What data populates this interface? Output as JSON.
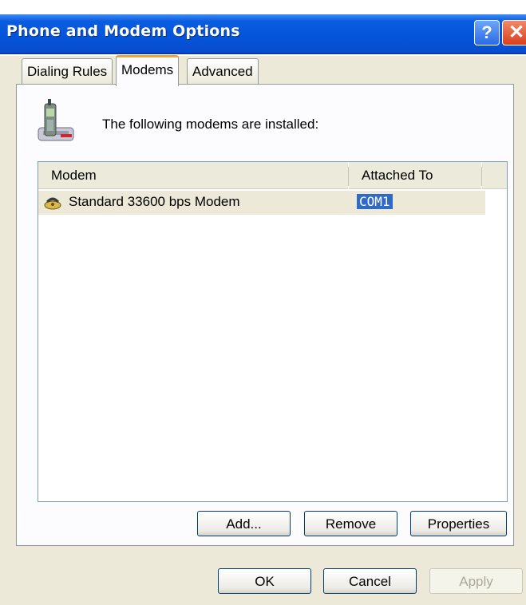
{
  "window": {
    "title": "Phone and Modem Options",
    "help_glyph": "?",
    "close_glyph": "✕"
  },
  "tabs": [
    {
      "label": "Dialing Rules",
      "active": false
    },
    {
      "label": "Modems",
      "active": true
    },
    {
      "label": "Advanced",
      "active": false
    }
  ],
  "modems_panel": {
    "intro_text": "The following modems are  installed:",
    "columns": [
      "Modem",
      "Attached To"
    ],
    "rows": [
      {
        "modem": "Standard 33600 bps Modem",
        "attached_to": "COM1",
        "selected": true
      }
    ],
    "buttons": {
      "add": "Add...",
      "remove": "Remove",
      "properties": "Properties"
    }
  },
  "dialog_buttons": {
    "ok": "OK",
    "cancel": "Cancel",
    "apply": "Apply",
    "apply_enabled": false
  },
  "colors": {
    "titlebar": "#0354d8",
    "selection": "#316ac5",
    "tab_highlight": "#e8a63c",
    "dialog_bg": "#ece9d8"
  }
}
